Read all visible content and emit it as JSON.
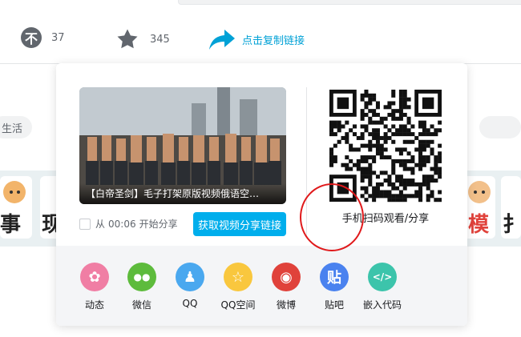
{
  "stats": {
    "coin_icon_glyph": "不",
    "coin_count": "37",
    "favorite_count": "345",
    "copy_link_label": "点击复制链接"
  },
  "background": {
    "tag_label": "生活",
    "banner_chars": [
      "事",
      "现",
      "模",
      "扌"
    ]
  },
  "popup": {
    "video_title": "【白帝圣剑】毛子打架原版视频俄语空…",
    "start_from_label": "从",
    "start_time": "00:06",
    "start_share_label": "开始分享",
    "get_link_button": "获取视频分享链接",
    "qr_label": "手机扫码观看/分享"
  },
  "share_targets": [
    {
      "label": "动态",
      "icon": "pinwheel-icon",
      "color": "#f07ea4",
      "glyph": "✿"
    },
    {
      "label": "微信",
      "icon": "wechat-icon",
      "color": "#5dbb3c",
      "glyph": "●●"
    },
    {
      "label": "QQ",
      "icon": "qq-icon",
      "color": "#4aa8ef",
      "glyph": "♟"
    },
    {
      "label": "QQ空间",
      "icon": "qzone-star-icon",
      "color": "#f9c73e",
      "glyph": "☆"
    },
    {
      "label": "微博",
      "icon": "weibo-icon",
      "color": "#e0423b",
      "glyph": "◉"
    },
    {
      "label": "贴吧",
      "icon": "tieba-icon",
      "color": "#4a82ef",
      "glyph": "贴"
    },
    {
      "label": "嵌入代码",
      "icon": "embed-code-icon",
      "color": "#3cc4ab",
      "glyph": "</>"
    }
  ],
  "colors": {
    "accent": "#00aeec",
    "link": "#00a1d6",
    "highlight_ring": "#e0191b"
  }
}
